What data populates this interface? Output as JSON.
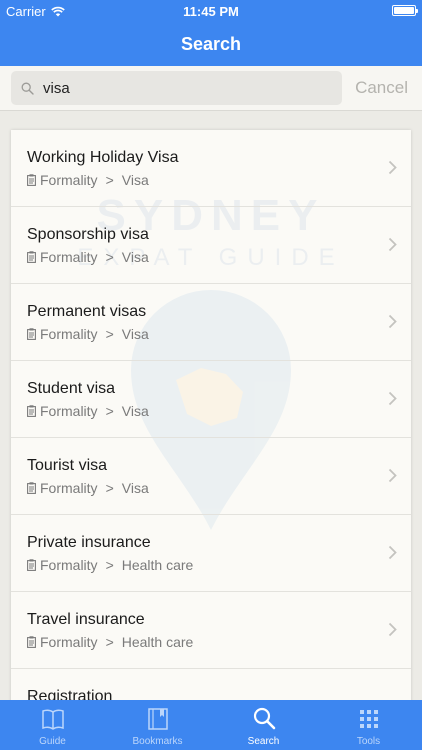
{
  "status_bar": {
    "carrier": "Carrier",
    "time": "11:45 PM"
  },
  "nav": {
    "title": "Search"
  },
  "search": {
    "value": "visa",
    "cancel_label": "Cancel"
  },
  "results": [
    {
      "title": "Working Holiday Visa",
      "category": "Formality",
      "separator": ">",
      "subcategory": "Visa"
    },
    {
      "title": "Sponsorship visa",
      "category": "Formality",
      "separator": ">",
      "subcategory": "Visa"
    },
    {
      "title": "Permanent visas",
      "category": "Formality",
      "separator": ">",
      "subcategory": "Visa"
    },
    {
      "title": "Student visa",
      "category": "Formality",
      "separator": ">",
      "subcategory": "Visa"
    },
    {
      "title": "Tourist visa",
      "category": "Formality",
      "separator": ">",
      "subcategory": "Visa"
    },
    {
      "title": "Private insurance",
      "category": "Formality",
      "separator": ">",
      "subcategory": "Health care"
    },
    {
      "title": "Travel insurance",
      "category": "Formality",
      "separator": ">",
      "subcategory": "Health care"
    },
    {
      "title": "Registration",
      "category": "",
      "separator": "",
      "subcategory": ""
    }
  ],
  "tabs": [
    {
      "label": "Guide",
      "icon": "book-icon",
      "active": false
    },
    {
      "label": "Bookmarks",
      "icon": "bookmark-icon",
      "active": false
    },
    {
      "label": "Search",
      "icon": "search-icon",
      "active": true
    },
    {
      "label": "Tools",
      "icon": "grid-icon",
      "active": false
    }
  ],
  "colors": {
    "accent": "#3d86f0",
    "background": "#ecebe6",
    "card": "#fbfaf6"
  }
}
